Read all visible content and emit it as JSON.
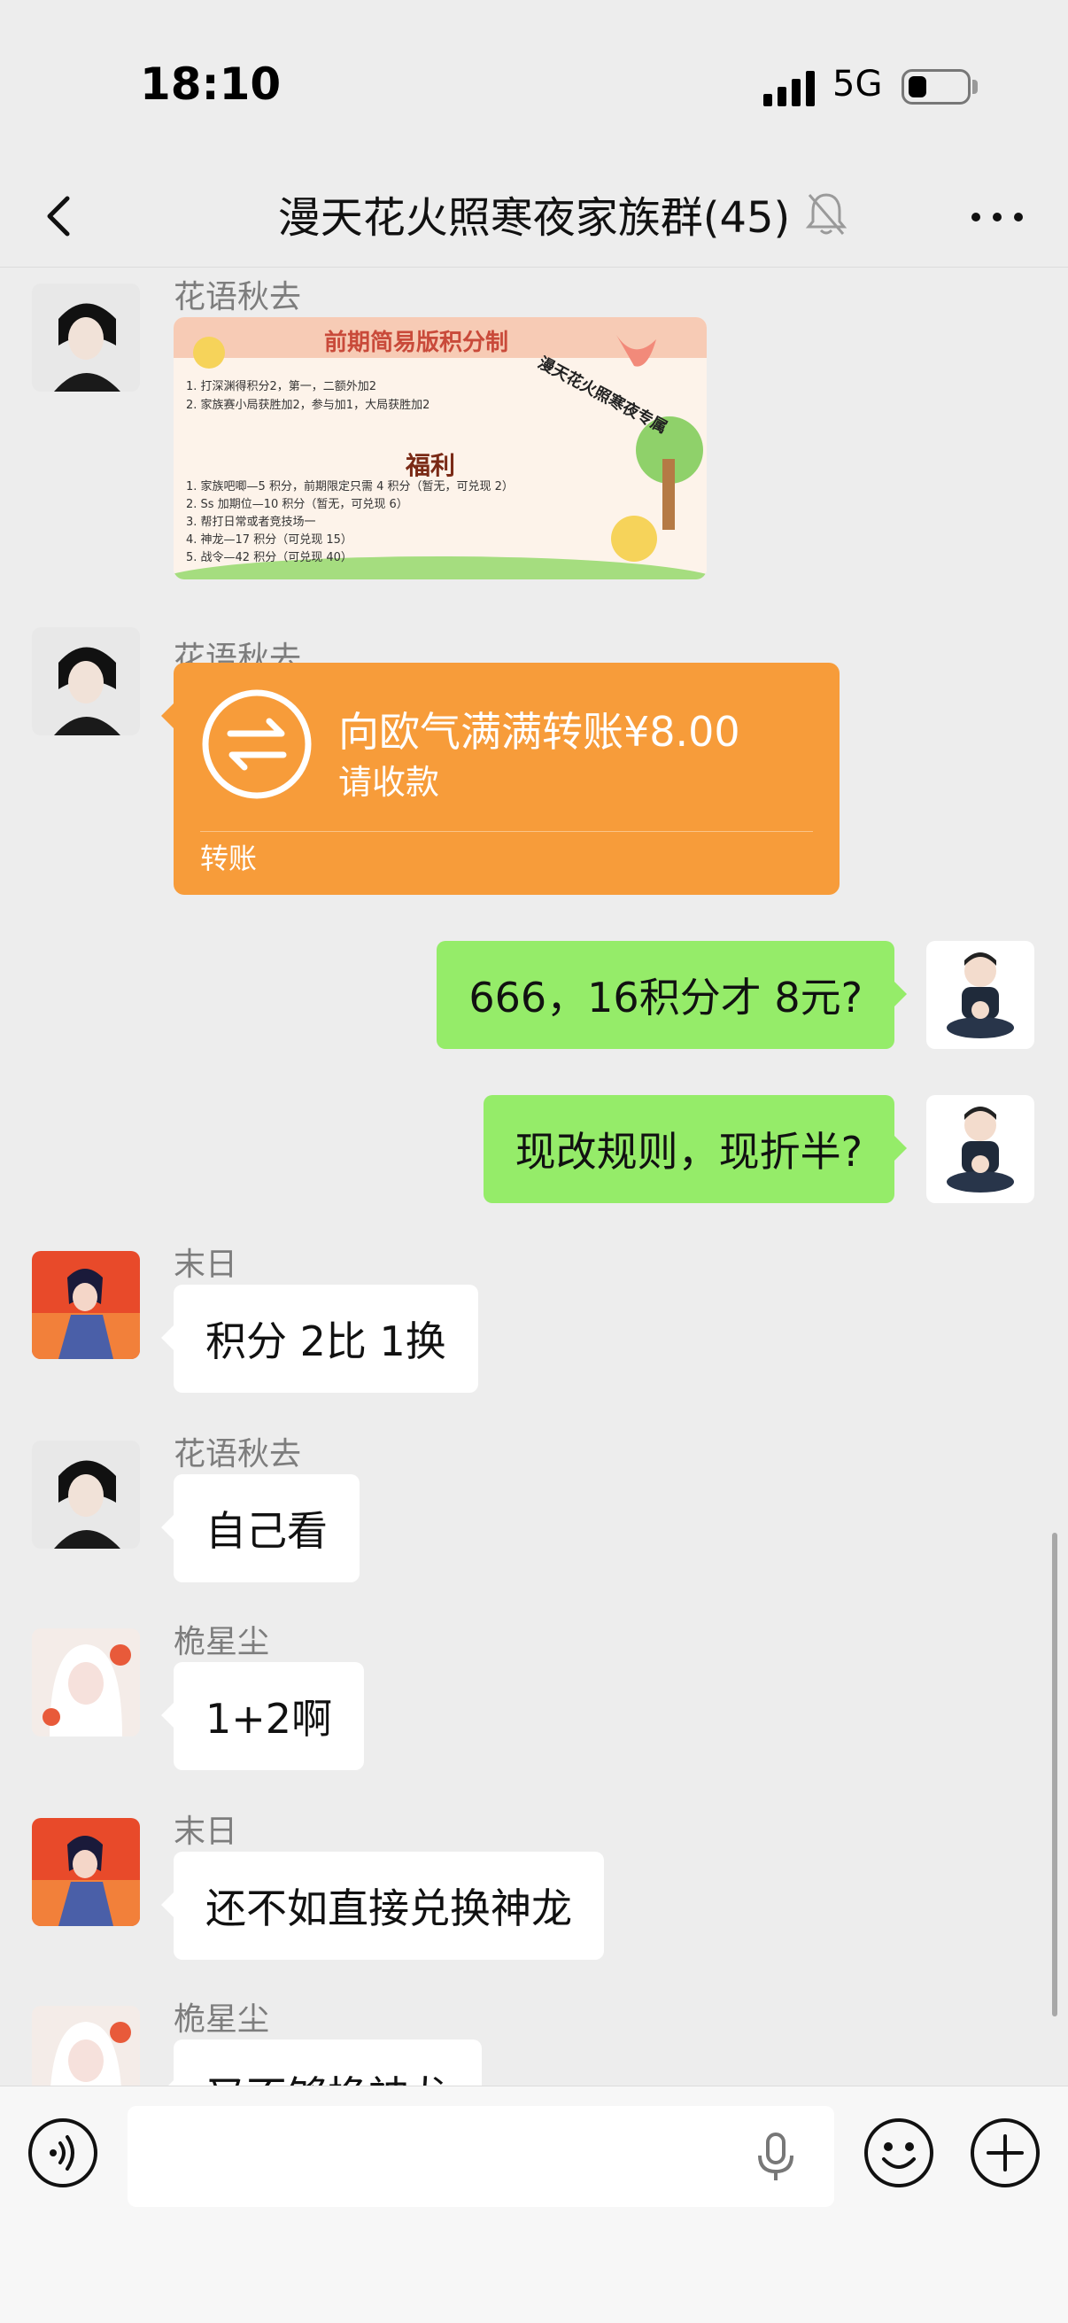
{
  "status_bar": {
    "time": "18:10",
    "network": "5G"
  },
  "header": {
    "title": "漫天花火照寒夜家族群(45)"
  },
  "image_card": {
    "title": "前期简易版积分制",
    "rules": [
      "1. 打深渊得积分2，第一，二额外加2",
      "2. 家族赛小局获胜加2，参与加1，大局获胜加2"
    ],
    "subtitle": "福利",
    "perks": [
      "1. 家族吧唧—5 积分，前期限定只需 4 积分（暂无，可兑现 2）",
      "2. Ss 加期位—10 积分（暂无，可兑现 6）",
      "3. 帮打日常或者竞技场一",
      "4. 神龙—17 积分（可兑现 15）",
      "5. 战令—42 积分（可兑现 40）"
    ],
    "stamp": "漫天花火照寒夜专属"
  },
  "messages": [
    {
      "sender": "花语秋去",
      "type": "image"
    },
    {
      "sender": "花语秋去",
      "type": "transfer",
      "main": "向欧气满满转账¥8.00",
      "sub": "请收款",
      "label": "转账"
    },
    {
      "type": "self",
      "text": "666，16积分才 8元?"
    },
    {
      "type": "self",
      "text": "现改规则，现折半?"
    },
    {
      "sender": "末日",
      "type": "text",
      "text": "积分 2比 1换"
    },
    {
      "sender": "花语秋去",
      "type": "text",
      "text": "自己看"
    },
    {
      "sender": "桅星尘",
      "type": "text",
      "text": "1+2啊"
    },
    {
      "sender": "末日",
      "type": "text",
      "text": "还不如直接兑换神龙"
    },
    {
      "sender": "桅星尘",
      "type": "text",
      "text": "又不够换神龙"
    }
  ],
  "input": {
    "value": ""
  }
}
